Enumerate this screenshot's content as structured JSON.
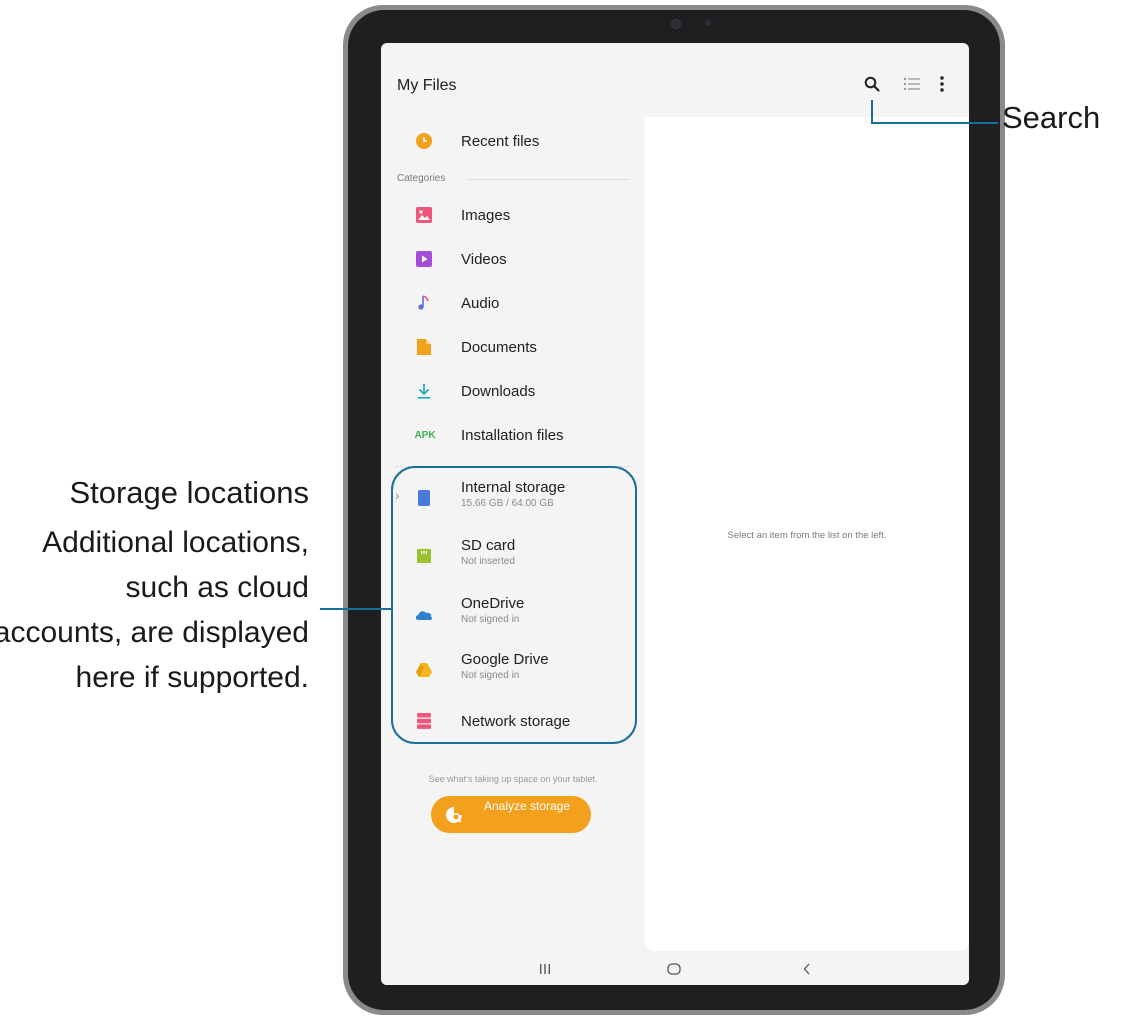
{
  "app": {
    "title": "My Files"
  },
  "toolbar": {
    "icons": [
      "search-icon",
      "list-view-icon",
      "more-options-icon"
    ]
  },
  "left_panel": {
    "recent": {
      "label": "Recent files",
      "icon": "clock-icon",
      "color": "#f3a01c"
    },
    "categories_title": "Categories",
    "categories": [
      {
        "label": "Images",
        "icon": "image-icon",
        "color": "#f0557a"
      },
      {
        "label": "Videos",
        "icon": "video-icon",
        "color": "#a24ed6"
      },
      {
        "label": "Audio",
        "icon": "music-note-icon",
        "color": "#5b6fe0"
      },
      {
        "label": "Documents",
        "icon": "document-icon",
        "color": "#f3a01c"
      },
      {
        "label": "Downloads",
        "icon": "download-icon",
        "color": "#18a8b8"
      },
      {
        "label": "Installation files",
        "icon": "apk-icon",
        "icon_text": "APK",
        "color": "#3bb24a"
      }
    ],
    "storage": [
      {
        "label": "Internal storage",
        "sub": "15.66 GB / 64.00 GB",
        "icon": "phone-icon",
        "color": "#4a7bd8"
      },
      {
        "label": "SD card",
        "sub": "Not inserted",
        "icon": "sd-card-icon",
        "color": "#9bc233"
      },
      {
        "label": "OneDrive",
        "sub": "Not signed in",
        "icon": "cloud-icon",
        "color": "#2f7fd1"
      },
      {
        "label": "Google Drive",
        "sub": "Not signed in",
        "icon": "drive-icon",
        "color": "#f3b61c"
      },
      {
        "label": "Network storage",
        "sub": "",
        "icon": "server-icon",
        "color": "#f0557a"
      }
    ],
    "hint": "See what's taking up space on your tablet.",
    "analyze_button": "Analyze storage"
  },
  "right_panel": {
    "message": "Select an item from the list on the left."
  },
  "navbar": {
    "icons": [
      "recent-apps-icon",
      "home-icon",
      "back-icon"
    ]
  },
  "callouts": {
    "search": "Search",
    "storage_title": "Storage locations",
    "storage_desc": "Additional locations, such as cloud accounts, are displayed here if supported.",
    "accent_color": "#1a6f9a"
  }
}
